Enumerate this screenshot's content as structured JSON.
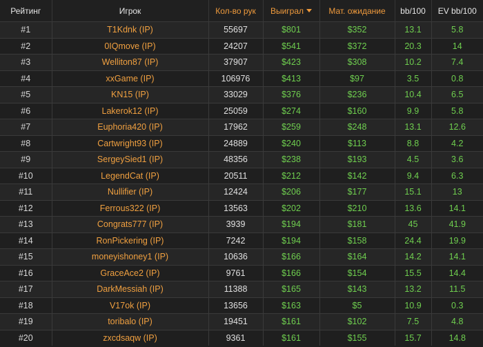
{
  "colors": {
    "background": "#1f1f1f",
    "row_alt": "#262626",
    "header_text": "#e6e6e6",
    "accent_orange": "#ef9a3c",
    "player_link": "#f0a040",
    "positive_green": "#6fcf4f"
  },
  "icons": {
    "sort": "caret-down-icon"
  },
  "table": {
    "headers": {
      "rank": "Рейтинг",
      "player": "Игрок",
      "hands": "Кол-во рук",
      "won": "Выиграл",
      "ev": "Мат. ожидание",
      "bb100": "bb/100",
      "evbb100": "EV bb/100"
    },
    "sorted_by": "won",
    "sort_direction": "desc",
    "rows": [
      {
        "rank": "#1",
        "player": "T1Kdnk (IP)",
        "hands": "55697",
        "won": "$801",
        "ev": "$352",
        "bb100": "13.1",
        "evbb100": "5.8"
      },
      {
        "rank": "#2",
        "player": "0IQmove (IP)",
        "hands": "24207",
        "won": "$541",
        "ev": "$372",
        "bb100": "20.3",
        "evbb100": "14"
      },
      {
        "rank": "#3",
        "player": "Welliton87 (IP)",
        "hands": "37907",
        "won": "$423",
        "ev": "$308",
        "bb100": "10.2",
        "evbb100": "7.4"
      },
      {
        "rank": "#4",
        "player": "xxGame (IP)",
        "hands": "106976",
        "won": "$413",
        "ev": "$97",
        "bb100": "3.5",
        "evbb100": "0.8"
      },
      {
        "rank": "#5",
        "player": "KN15 (IP)",
        "hands": "33029",
        "won": "$376",
        "ev": "$236",
        "bb100": "10.4",
        "evbb100": "6.5"
      },
      {
        "rank": "#6",
        "player": "Lakerok12 (IP)",
        "hands": "25059",
        "won": "$274",
        "ev": "$160",
        "bb100": "9.9",
        "evbb100": "5.8"
      },
      {
        "rank": "#7",
        "player": "Euphoria420 (IP)",
        "hands": "17962",
        "won": "$259",
        "ev": "$248",
        "bb100": "13.1",
        "evbb100": "12.6"
      },
      {
        "rank": "#8",
        "player": "Cartwright93 (IP)",
        "hands": "24889",
        "won": "$240",
        "ev": "$113",
        "bb100": "8.8",
        "evbb100": "4.2"
      },
      {
        "rank": "#9",
        "player": "SergeySied1 (IP)",
        "hands": "48356",
        "won": "$238",
        "ev": "$193",
        "bb100": "4.5",
        "evbb100": "3.6"
      },
      {
        "rank": "#10",
        "player": "LegendCat (IP)",
        "hands": "20511",
        "won": "$212",
        "ev": "$142",
        "bb100": "9.4",
        "evbb100": "6.3"
      },
      {
        "rank": "#11",
        "player": "Nullifier (IP)",
        "hands": "12424",
        "won": "$206",
        "ev": "$177",
        "bb100": "15.1",
        "evbb100": "13"
      },
      {
        "rank": "#12",
        "player": "Ferrous322 (IP)",
        "hands": "13563",
        "won": "$202",
        "ev": "$210",
        "bb100": "13.6",
        "evbb100": "14.1"
      },
      {
        "rank": "#13",
        "player": "Congrats777 (IP)",
        "hands": "3939",
        "won": "$194",
        "ev": "$181",
        "bb100": "45",
        "evbb100": "41.9"
      },
      {
        "rank": "#14",
        "player": "RonPickering (IP)",
        "hands": "7242",
        "won": "$194",
        "ev": "$158",
        "bb100": "24.4",
        "evbb100": "19.9"
      },
      {
        "rank": "#15",
        "player": "moneyishoney1 (IP)",
        "hands": "10636",
        "won": "$166",
        "ev": "$164",
        "bb100": "14.2",
        "evbb100": "14.1"
      },
      {
        "rank": "#16",
        "player": "GraceAce2 (IP)",
        "hands": "9761",
        "won": "$166",
        "ev": "$154",
        "bb100": "15.5",
        "evbb100": "14.4"
      },
      {
        "rank": "#17",
        "player": "DarkMessiah (IP)",
        "hands": "11388",
        "won": "$165",
        "ev": "$143",
        "bb100": "13.2",
        "evbb100": "11.5"
      },
      {
        "rank": "#18",
        "player": "V17ok (IP)",
        "hands": "13656",
        "won": "$163",
        "ev": "$5",
        "bb100": "10.9",
        "evbb100": "0.3"
      },
      {
        "rank": "#19",
        "player": "toribalo (IP)",
        "hands": "19451",
        "won": "$161",
        "ev": "$102",
        "bb100": "7.5",
        "evbb100": "4.8"
      },
      {
        "rank": "#20",
        "player": "zxcdsaqw (IP)",
        "hands": "9361",
        "won": "$161",
        "ev": "$155",
        "bb100": "15.7",
        "evbb100": "14.8"
      }
    ]
  }
}
